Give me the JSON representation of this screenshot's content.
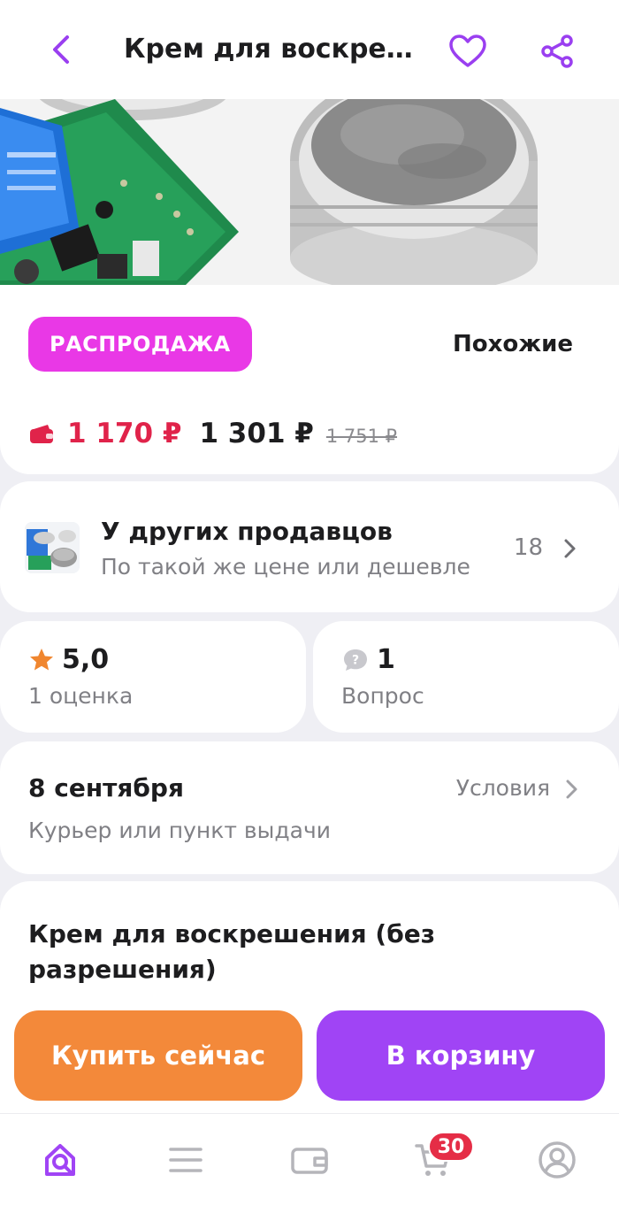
{
  "header": {
    "title": "Крем для воскреше...",
    "back_icon": "chevron-left-icon",
    "favorite_icon": "heart-icon",
    "share_icon": "share-icon"
  },
  "promo": {
    "badge": "РАСПРОДАЖА",
    "similar_label": "Похожие"
  },
  "price": {
    "card_price": "1 170 ₽",
    "price": "1 301 ₽",
    "old_price": "1 751 ₽"
  },
  "other_sellers": {
    "title": "У других продавцов",
    "subtitle": "По такой же цене или дешевле",
    "count": "18"
  },
  "rating": {
    "value": "5,0",
    "label": "1 оценка"
  },
  "questions": {
    "count": "1",
    "label": "Вопрос"
  },
  "delivery": {
    "date": "8 сентября",
    "method": "Курьер или пункт выдачи",
    "conditions_label": "Условия"
  },
  "description": {
    "title": "Крем для воскрешения (без разрешения)"
  },
  "actions": {
    "buy_now": "Купить сейчас",
    "add_to_cart": "В корзину"
  },
  "tabbar": {
    "cart_badge": "30"
  },
  "colors": {
    "accent": "#a044f5",
    "sale_badge": "#e938e6",
    "buy_button": "#f3893a",
    "card_price": "#e0234a"
  }
}
